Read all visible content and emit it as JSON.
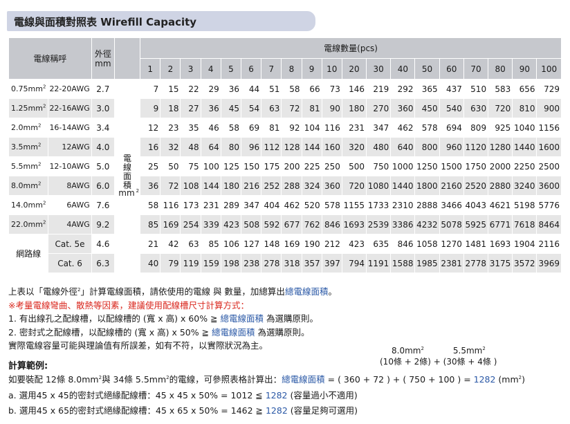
{
  "title": "電線與面積對照表  Wirefill Capacity",
  "header": {
    "name_col": "電線稱呼",
    "od_col": "外徑\nmm",
    "count_label": "電線數量(pcs)",
    "counts": [
      "1",
      "2",
      "3",
      "4",
      "5",
      "6",
      "7",
      "8",
      "9",
      "10",
      "20",
      "30",
      "40",
      "50",
      "60",
      "70",
      "80",
      "90",
      "100"
    ],
    "unit_chars": [
      "電",
      "線",
      "面",
      "積"
    ],
    "unit_mm": "mm",
    "unit_sup": "2"
  },
  "rows": [
    {
      "a": "0.75mm",
      "b": "22-20AWG",
      "od": "2.7",
      "v": [
        "7",
        "15",
        "22",
        "29",
        "36",
        "44",
        "51",
        "58",
        "66",
        "73",
        "146",
        "219",
        "292",
        "365",
        "437",
        "510",
        "583",
        "656",
        "729"
      ]
    },
    {
      "a": "1.25mm",
      "b": "22-16AWG",
      "od": "3.0",
      "v": [
        "9",
        "18",
        "27",
        "36",
        "45",
        "54",
        "63",
        "72",
        "81",
        "90",
        "180",
        "270",
        "360",
        "450",
        "540",
        "630",
        "720",
        "810",
        "900"
      ]
    },
    {
      "a": "2.0mm",
      "b": "16-14AWG",
      "od": "3.4",
      "v": [
        "12",
        "23",
        "35",
        "46",
        "58",
        "69",
        "81",
        "92",
        "104",
        "116",
        "231",
        "347",
        "462",
        "578",
        "694",
        "809",
        "925",
        "1040",
        "1156"
      ]
    },
    {
      "a": "3.5mm",
      "b": "12AWG",
      "od": "4.0",
      "v": [
        "16",
        "32",
        "48",
        "64",
        "80",
        "96",
        "112",
        "128",
        "144",
        "160",
        "320",
        "480",
        "640",
        "800",
        "960",
        "1120",
        "1280",
        "1440",
        "1600"
      ]
    },
    {
      "a": "5.5mm",
      "b": "12-10AWG",
      "od": "5.0",
      "v": [
        "25",
        "50",
        "75",
        "100",
        "125",
        "150",
        "175",
        "200",
        "225",
        "250",
        "500",
        "750",
        "1000",
        "1250",
        "1500",
        "1750",
        "2000",
        "2250",
        "2500"
      ]
    },
    {
      "a": "8.0mm",
      "b": "8AWG",
      "od": "6.0",
      "v": [
        "36",
        "72",
        "108",
        "144",
        "180",
        "216",
        "252",
        "288",
        "324",
        "360",
        "720",
        "1080",
        "1440",
        "1800",
        "2160",
        "2520",
        "2880",
        "3240",
        "3600"
      ]
    },
    {
      "a": "14.0mm",
      "b": "6AWG",
      "od": "7.6",
      "v": [
        "58",
        "116",
        "173",
        "231",
        "289",
        "347",
        "404",
        "462",
        "520",
        "578",
        "1155",
        "1733",
        "2310",
        "2888",
        "3466",
        "4043",
        "4621",
        "5198",
        "5776"
      ]
    },
    {
      "a": "22.0mm",
      "b": "4AWG",
      "od": "9.2",
      "v": [
        "85",
        "169",
        "254",
        "339",
        "423",
        "508",
        "592",
        "677",
        "762",
        "846",
        "1693",
        "2539",
        "3386",
        "4232",
        "5078",
        "5925",
        "6771",
        "7618",
        "8464"
      ]
    }
  ],
  "network": {
    "label": "網路線",
    "rows": [
      {
        "cat": "Cat. 5e",
        "od": "4.6",
        "v": [
          "21",
          "42",
          "63",
          "85",
          "106",
          "127",
          "148",
          "169",
          "190",
          "212",
          "423",
          "635",
          "846",
          "1058",
          "1270",
          "1481",
          "1693",
          "1904",
          "2116"
        ]
      },
      {
        "cat": "Cat. 6",
        "od": "6.3",
        "v": [
          "40",
          "79",
          "119",
          "159",
          "198",
          "238",
          "278",
          "318",
          "357",
          "397",
          "794",
          "1191",
          "1588",
          "1985",
          "2381",
          "2778",
          "3175",
          "3572",
          "3969"
        ]
      }
    ]
  },
  "notes": {
    "l1a": "上表以「電線外徑",
    "l1b": "」計算電線面積，請依使用的電線 與 數量，加總算出",
    "l1c": "總電線面積",
    "l1d": "。",
    "l2": "※考量電線彎曲、散熱等因素，建議使用配線槽尺寸計算方式：",
    "l3a": "1. 有出線孔之配線槽，以配線槽的 (寬 x 高) x 60% ≧ ",
    "l3b": "總電線面積",
    "l3c": " 為選購原則。",
    "l4a": "2. 密封式之配線槽，以配線槽的 (寬 x 高) x 50% ≧ ",
    "l4b": "總電線面積",
    "l4c": " 為選購原則。",
    "l5": "實際電線容量可能與理論值有所誤差，如有不符，以實際狀況為主。"
  },
  "calc": {
    "title": "計算範例:",
    "frac_a": "8.0mm",
    "frac_a2": "5.5mm",
    "frac_b": "(10條 + 2條) + (30條 + 4條 )",
    "l1a": "如要裝配 12條 8.0mm",
    "l1b": "與 34條 5.5mm",
    "l1c": "的電線，可參照表格計算出：",
    "l1d": "總電線面積",
    "l1e": " = ( 360 + 72 ) + ( 750 + 100 ) = ",
    "l1f": "1282",
    "l1g": " (mm",
    "l1h": ")",
    "la1": "a. 選用45 x 45的密封式絕緣配線槽：45 x 45 x 50% = 1012 ≦ ",
    "la2": "1282",
    "la3": " (容量過小不適用)",
    "lb1": "b. 選用45 x 65的密封式絕緣配線槽：45 x 65 x 50% = 1462 ≧ ",
    "lb2": "1282",
    "lb3": " (容量足夠可選用)"
  }
}
